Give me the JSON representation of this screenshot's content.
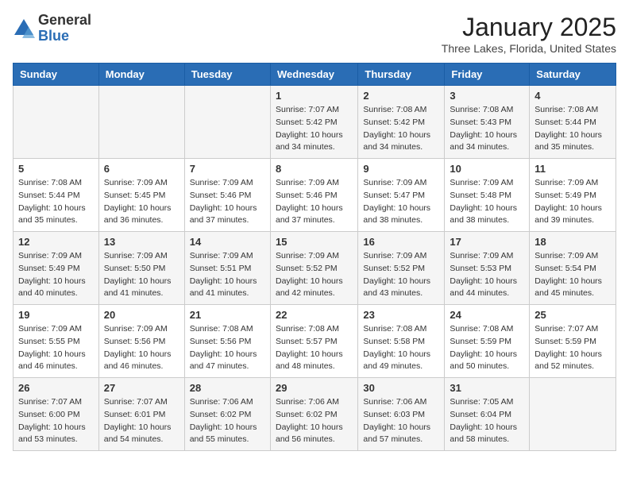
{
  "logo": {
    "general": "General",
    "blue": "Blue"
  },
  "title": "January 2025",
  "location": "Three Lakes, Florida, United States",
  "weekdays": [
    "Sunday",
    "Monday",
    "Tuesday",
    "Wednesday",
    "Thursday",
    "Friday",
    "Saturday"
  ],
  "weeks": [
    [
      {
        "day": "",
        "info": ""
      },
      {
        "day": "",
        "info": ""
      },
      {
        "day": "",
        "info": ""
      },
      {
        "day": "1",
        "info": "Sunrise: 7:07 AM\nSunset: 5:42 PM\nDaylight: 10 hours\nand 34 minutes."
      },
      {
        "day": "2",
        "info": "Sunrise: 7:08 AM\nSunset: 5:42 PM\nDaylight: 10 hours\nand 34 minutes."
      },
      {
        "day": "3",
        "info": "Sunrise: 7:08 AM\nSunset: 5:43 PM\nDaylight: 10 hours\nand 34 minutes."
      },
      {
        "day": "4",
        "info": "Sunrise: 7:08 AM\nSunset: 5:44 PM\nDaylight: 10 hours\nand 35 minutes."
      }
    ],
    [
      {
        "day": "5",
        "info": "Sunrise: 7:08 AM\nSunset: 5:44 PM\nDaylight: 10 hours\nand 35 minutes."
      },
      {
        "day": "6",
        "info": "Sunrise: 7:09 AM\nSunset: 5:45 PM\nDaylight: 10 hours\nand 36 minutes."
      },
      {
        "day": "7",
        "info": "Sunrise: 7:09 AM\nSunset: 5:46 PM\nDaylight: 10 hours\nand 37 minutes."
      },
      {
        "day": "8",
        "info": "Sunrise: 7:09 AM\nSunset: 5:46 PM\nDaylight: 10 hours\nand 37 minutes."
      },
      {
        "day": "9",
        "info": "Sunrise: 7:09 AM\nSunset: 5:47 PM\nDaylight: 10 hours\nand 38 minutes."
      },
      {
        "day": "10",
        "info": "Sunrise: 7:09 AM\nSunset: 5:48 PM\nDaylight: 10 hours\nand 38 minutes."
      },
      {
        "day": "11",
        "info": "Sunrise: 7:09 AM\nSunset: 5:49 PM\nDaylight: 10 hours\nand 39 minutes."
      }
    ],
    [
      {
        "day": "12",
        "info": "Sunrise: 7:09 AM\nSunset: 5:49 PM\nDaylight: 10 hours\nand 40 minutes."
      },
      {
        "day": "13",
        "info": "Sunrise: 7:09 AM\nSunset: 5:50 PM\nDaylight: 10 hours\nand 41 minutes."
      },
      {
        "day": "14",
        "info": "Sunrise: 7:09 AM\nSunset: 5:51 PM\nDaylight: 10 hours\nand 41 minutes."
      },
      {
        "day": "15",
        "info": "Sunrise: 7:09 AM\nSunset: 5:52 PM\nDaylight: 10 hours\nand 42 minutes."
      },
      {
        "day": "16",
        "info": "Sunrise: 7:09 AM\nSunset: 5:52 PM\nDaylight: 10 hours\nand 43 minutes."
      },
      {
        "day": "17",
        "info": "Sunrise: 7:09 AM\nSunset: 5:53 PM\nDaylight: 10 hours\nand 44 minutes."
      },
      {
        "day": "18",
        "info": "Sunrise: 7:09 AM\nSunset: 5:54 PM\nDaylight: 10 hours\nand 45 minutes."
      }
    ],
    [
      {
        "day": "19",
        "info": "Sunrise: 7:09 AM\nSunset: 5:55 PM\nDaylight: 10 hours\nand 46 minutes."
      },
      {
        "day": "20",
        "info": "Sunrise: 7:09 AM\nSunset: 5:56 PM\nDaylight: 10 hours\nand 46 minutes."
      },
      {
        "day": "21",
        "info": "Sunrise: 7:08 AM\nSunset: 5:56 PM\nDaylight: 10 hours\nand 47 minutes."
      },
      {
        "day": "22",
        "info": "Sunrise: 7:08 AM\nSunset: 5:57 PM\nDaylight: 10 hours\nand 48 minutes."
      },
      {
        "day": "23",
        "info": "Sunrise: 7:08 AM\nSunset: 5:58 PM\nDaylight: 10 hours\nand 49 minutes."
      },
      {
        "day": "24",
        "info": "Sunrise: 7:08 AM\nSunset: 5:59 PM\nDaylight: 10 hours\nand 50 minutes."
      },
      {
        "day": "25",
        "info": "Sunrise: 7:07 AM\nSunset: 5:59 PM\nDaylight: 10 hours\nand 52 minutes."
      }
    ],
    [
      {
        "day": "26",
        "info": "Sunrise: 7:07 AM\nSunset: 6:00 PM\nDaylight: 10 hours\nand 53 minutes."
      },
      {
        "day": "27",
        "info": "Sunrise: 7:07 AM\nSunset: 6:01 PM\nDaylight: 10 hours\nand 54 minutes."
      },
      {
        "day": "28",
        "info": "Sunrise: 7:06 AM\nSunset: 6:02 PM\nDaylight: 10 hours\nand 55 minutes."
      },
      {
        "day": "29",
        "info": "Sunrise: 7:06 AM\nSunset: 6:02 PM\nDaylight: 10 hours\nand 56 minutes."
      },
      {
        "day": "30",
        "info": "Sunrise: 7:06 AM\nSunset: 6:03 PM\nDaylight: 10 hours\nand 57 minutes."
      },
      {
        "day": "31",
        "info": "Sunrise: 7:05 AM\nSunset: 6:04 PM\nDaylight: 10 hours\nand 58 minutes."
      },
      {
        "day": "",
        "info": ""
      }
    ]
  ]
}
